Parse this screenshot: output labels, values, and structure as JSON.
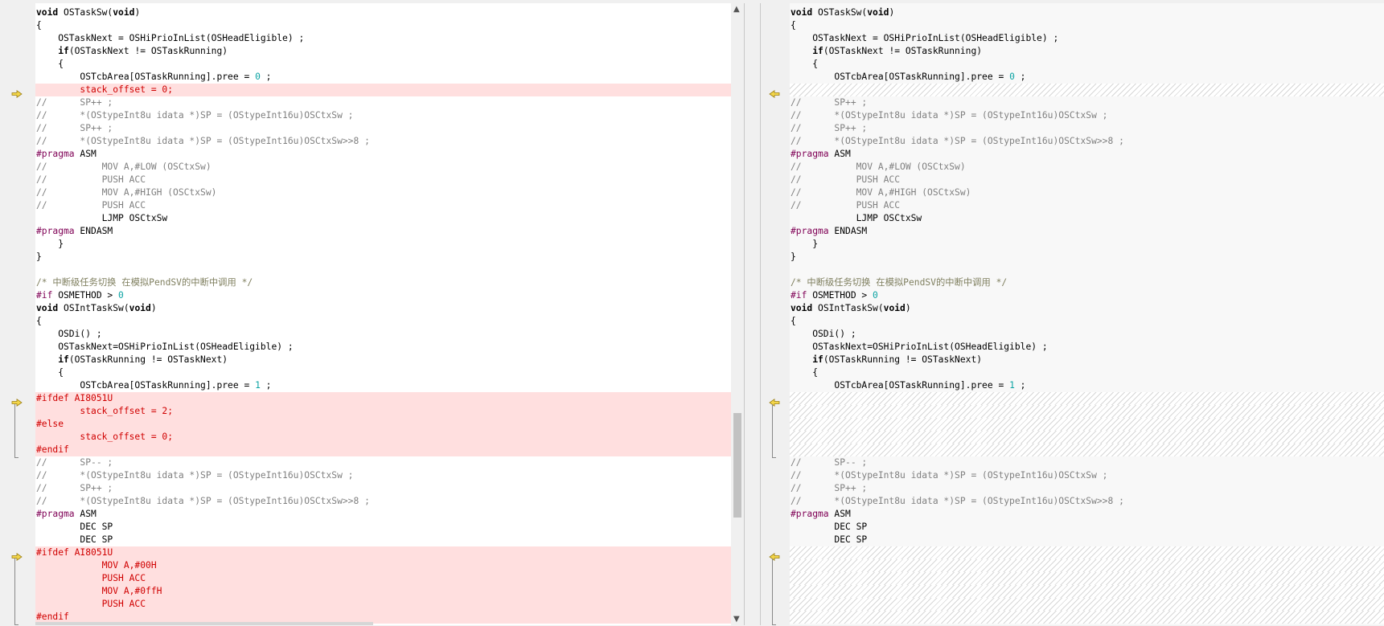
{
  "left_lines": [
    {
      "t": "void OSTaskSw(void)",
      "k": "n"
    },
    {
      "t": "{",
      "k": "n"
    },
    {
      "t": "    OSTaskNext = OSHiPrioInList(OSHeadEligible) ;",
      "k": "n"
    },
    {
      "t": "    if(OSTaskNext != OSTaskRunning)",
      "k": "n"
    },
    {
      "t": "    {",
      "k": "n"
    },
    {
      "t": "        OSTcbArea[OSTaskRunning].pree = 0 ;",
      "k": "n"
    },
    {
      "t": "        stack_offset = 0;",
      "k": "d"
    },
    {
      "t": "//      SP++ ;",
      "k": "c"
    },
    {
      "t": "//      *(OStypeInt8u idata *)SP = (OStypeInt16u)OSCtxSw ;",
      "k": "c"
    },
    {
      "t": "//      SP++ ;",
      "k": "c"
    },
    {
      "t": "//      *(OStypeInt8u idata *)SP = (OStypeInt16u)OSCtxSw>>8 ;",
      "k": "c"
    },
    {
      "t": "#pragma ASM",
      "k": "p"
    },
    {
      "t": "//          MOV A,#LOW (OSCtxSw)",
      "k": "c"
    },
    {
      "t": "//          PUSH ACC",
      "k": "c"
    },
    {
      "t": "//          MOV A,#HIGH (OSCtxSw)",
      "k": "c"
    },
    {
      "t": "//          PUSH ACC",
      "k": "c"
    },
    {
      "t": "            LJMP OSCtxSw",
      "k": "n"
    },
    {
      "t": "#pragma ENDASM",
      "k": "p"
    },
    {
      "t": "    }",
      "k": "n"
    },
    {
      "t": "}",
      "k": "n"
    },
    {
      "t": "",
      "k": "n"
    },
    {
      "t": "/* 中断级任务切换 在模拟PendSV的中断中调用 */",
      "k": "c"
    },
    {
      "t": "#if OSMETHOD > 0",
      "k": "p"
    },
    {
      "t": "void OSIntTaskSw(void)",
      "k": "n"
    },
    {
      "t": "{",
      "k": "n"
    },
    {
      "t": "    OSDi() ;",
      "k": "n"
    },
    {
      "t": "    OSTaskNext=OSHiPrioInList(OSHeadEligible) ;",
      "k": "n"
    },
    {
      "t": "    if(OSTaskRunning != OSTaskNext)",
      "k": "n"
    },
    {
      "t": "    {",
      "k": "n"
    },
    {
      "t": "        OSTcbArea[OSTaskRunning].pree = 1 ;",
      "k": "n"
    },
    {
      "t": "#ifdef AI8051U",
      "k": "d"
    },
    {
      "t": "        stack_offset = 2;",
      "k": "d"
    },
    {
      "t": "#else",
      "k": "d"
    },
    {
      "t": "        stack_offset = 0;",
      "k": "d"
    },
    {
      "t": "#endif",
      "k": "d"
    },
    {
      "t": "//      SP-- ;",
      "k": "c"
    },
    {
      "t": "//      *(OStypeInt8u idata *)SP = (OStypeInt16u)OSCtxSw ;",
      "k": "c"
    },
    {
      "t": "//      SP++ ;",
      "k": "c"
    },
    {
      "t": "//      *(OStypeInt8u idata *)SP = (OStypeInt16u)OSCtxSw>>8 ;",
      "k": "c"
    },
    {
      "t": "#pragma ASM",
      "k": "p"
    },
    {
      "t": "        DEC SP",
      "k": "n"
    },
    {
      "t": "        DEC SP",
      "k": "n"
    },
    {
      "t": "#ifdef AI8051U",
      "k": "d"
    },
    {
      "t": "            MOV A,#00H",
      "k": "d"
    },
    {
      "t": "            PUSH ACC",
      "k": "d"
    },
    {
      "t": "            MOV A,#0ffH",
      "k": "d"
    },
    {
      "t": "            PUSH ACC",
      "k": "d"
    },
    {
      "t": "#endif",
      "k": "d"
    }
  ],
  "right_lines": [
    {
      "t": "void OSTaskSw(void)",
      "k": "n"
    },
    {
      "t": "{",
      "k": "n"
    },
    {
      "t": "    OSTaskNext = OSHiPrioInList(OSHeadEligible) ;",
      "k": "n"
    },
    {
      "t": "    if(OSTaskNext != OSTaskRunning)",
      "k": "n"
    },
    {
      "t": "    {",
      "k": "n"
    },
    {
      "t": "        OSTcbArea[OSTaskRunning].pree = 0 ;",
      "k": "n"
    },
    {
      "t": "",
      "k": "h"
    },
    {
      "t": "//      SP++ ;",
      "k": "c"
    },
    {
      "t": "//      *(OStypeInt8u idata *)SP = (OStypeInt16u)OSCtxSw ;",
      "k": "c"
    },
    {
      "t": "//      SP++ ;",
      "k": "c"
    },
    {
      "t": "//      *(OStypeInt8u idata *)SP = (OStypeInt16u)OSCtxSw>>8 ;",
      "k": "c"
    },
    {
      "t": "#pragma ASM",
      "k": "p"
    },
    {
      "t": "//          MOV A,#LOW (OSCtxSw)",
      "k": "c"
    },
    {
      "t": "//          PUSH ACC",
      "k": "c"
    },
    {
      "t": "//          MOV A,#HIGH (OSCtxSw)",
      "k": "c"
    },
    {
      "t": "//          PUSH ACC",
      "k": "c"
    },
    {
      "t": "            LJMP OSCtxSw",
      "k": "n"
    },
    {
      "t": "#pragma ENDASM",
      "k": "p"
    },
    {
      "t": "    }",
      "k": "n"
    },
    {
      "t": "}",
      "k": "n"
    },
    {
      "t": "",
      "k": "n"
    },
    {
      "t": "/* 中断级任务切换 在模拟PendSV的中断中调用 */",
      "k": "c"
    },
    {
      "t": "#if OSMETHOD > 0",
      "k": "p"
    },
    {
      "t": "void OSIntTaskSw(void)",
      "k": "n"
    },
    {
      "t": "{",
      "k": "n"
    },
    {
      "t": "    OSDi() ;",
      "k": "n"
    },
    {
      "t": "    OSTaskNext=OSHiPrioInList(OSHeadEligible) ;",
      "k": "n"
    },
    {
      "t": "    if(OSTaskRunning != OSTaskNext)",
      "k": "n"
    },
    {
      "t": "    {",
      "k": "n"
    },
    {
      "t": "        OSTcbArea[OSTaskRunning].pree = 1 ;",
      "k": "n"
    },
    {
      "t": "",
      "k": "h"
    },
    {
      "t": "",
      "k": "h"
    },
    {
      "t": "",
      "k": "h"
    },
    {
      "t": "",
      "k": "h"
    },
    {
      "t": "",
      "k": "h"
    },
    {
      "t": "//      SP-- ;",
      "k": "c"
    },
    {
      "t": "//      *(OStypeInt8u idata *)SP = (OStypeInt16u)OSCtxSw ;",
      "k": "c"
    },
    {
      "t": "//      SP++ ;",
      "k": "c"
    },
    {
      "t": "//      *(OStypeInt8u idata *)SP = (OStypeInt16u)OSCtxSw>>8 ;",
      "k": "c"
    },
    {
      "t": "#pragma ASM",
      "k": "p"
    },
    {
      "t": "        DEC SP",
      "k": "n"
    },
    {
      "t": "        DEC SP",
      "k": "n"
    },
    {
      "t": "",
      "k": "h"
    },
    {
      "t": "",
      "k": "h"
    },
    {
      "t": "",
      "k": "h"
    },
    {
      "t": "",
      "k": "h"
    },
    {
      "t": "",
      "k": "h"
    },
    {
      "t": "",
      "k": "h"
    }
  ],
  "diff_blocks": [
    6,
    30,
    42
  ],
  "scroll": {
    "up_icon": "▲",
    "down_icon": "▼"
  },
  "colors": {
    "diff_bg": "#ffdfdf",
    "diff_text": "#d00000",
    "comment": "#808080",
    "number": "#0aa3a3",
    "arrow": "#f3d64a"
  }
}
